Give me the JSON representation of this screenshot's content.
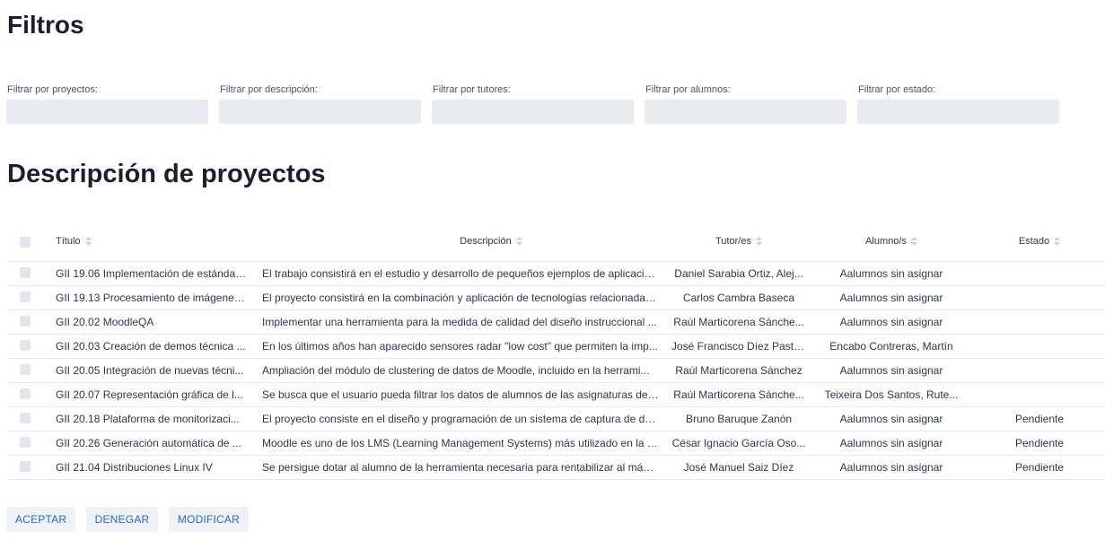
{
  "filters": {
    "title": "Filtros",
    "fields": [
      {
        "label": "Filtrar por proyectos:",
        "value": ""
      },
      {
        "label": "Filtrar por descripción:",
        "value": ""
      },
      {
        "label": "Filtrar por tutores:",
        "value": ""
      },
      {
        "label": "Filtrar por alumnos:",
        "value": ""
      },
      {
        "label": "Filtrar por estado:",
        "value": ""
      }
    ]
  },
  "projects": {
    "title": "Descripción de proyectos",
    "columns": {
      "title": "Título",
      "description": "Descripción",
      "tutors": "Tutor/es",
      "students": "Alumno/s",
      "status": "Estado"
    },
    "sort_icon": "sort-updown-icon",
    "rows": [
      {
        "title": "GII 19.06 Implementación de estándares...",
        "description": "El trabajo consistirá en el estudio y desarrollo de pequeños ejemplos de aplicación...",
        "tutors": "Daniel Sarabia Ortiz, Alej...",
        "students": "Aalumnos sin asignar",
        "status": ""
      },
      {
        "title": "GII 19.13 Procesamiento de imágenes...",
        "description": "El proyecto consistirá en la combinación y aplicación de tecnologías relacionadas...",
        "tutors": "Carlos Cambra Baseca",
        "students": "Aalumnos sin asignar",
        "status": ""
      },
      {
        "title": "GII 20.02 MoodleQA",
        "description": "Implementar una herramienta para la medida de calidad del diseño instruccional ...",
        "tutors": "Raúl Marticorena Sánche...",
        "students": "Aalumnos sin asignar",
        "status": ""
      },
      {
        "title": "GII 20.03 Creación de demos técnica ...",
        "description": "En los últimos años han aparecido sensores radar \"low cost\" que permiten la imp...",
        "tutors": "José Francisco Díez Pasto...",
        "students": "Encabo Contreras, Martín",
        "status": ""
      },
      {
        "title": "GII 20.05 Integración de nuevas técni...",
        "description": "Ampliación del módulo de clustering de datos de Moodle, incluido en la herrami...",
        "tutors": "Raúl Marticorena Sánchez",
        "students": "Aalumnos sin asignar",
        "status": ""
      },
      {
        "title": "GII 20.07 Representación gráfica de l...",
        "description": "Se busca que el usuario pueda filtrar los datos de alumnos de las asignaturas de l...",
        "tutors": "Raúl Marticorena Sánche...",
        "students": "Teixeira Dos Santos, Rute...",
        "status": ""
      },
      {
        "title": "GII 20.18 Plataforma de monitorizaci...",
        "description": "El proyecto consiste en el diseño y programación de un sistema de captura de da...",
        "tutors": "Bruno Baruque Zanón",
        "students": "Aalumnos sin asignar",
        "status": "Pendiente"
      },
      {
        "title": "GII 20.26 Generación automática de ...",
        "description": "Moodle es uno de los LMS (Learning Management Systems) más utilizado en la a...",
        "tutors": "César Ignacio García Oso...",
        "students": "Aalumnos sin asignar",
        "status": "Pendiente"
      },
      {
        "title": "GII 21.04 Distribuciones Linux IV",
        "description": "Se persigue dotar al alumno de la herramienta necesaria para rentabilizar al máxi...",
        "tutors": "José Manuel Saiz Díez",
        "students": "Aalumnos sin asignar",
        "status": "Pendiente"
      }
    ]
  },
  "actions": {
    "accept": "ACEPTAR",
    "deny": "DENEGAR",
    "modify": "MODIFICAR"
  },
  "colors": {
    "input_bg": "#e8ebf0",
    "button_text": "#2b6cb0",
    "button_bg": "#eef1f5"
  }
}
